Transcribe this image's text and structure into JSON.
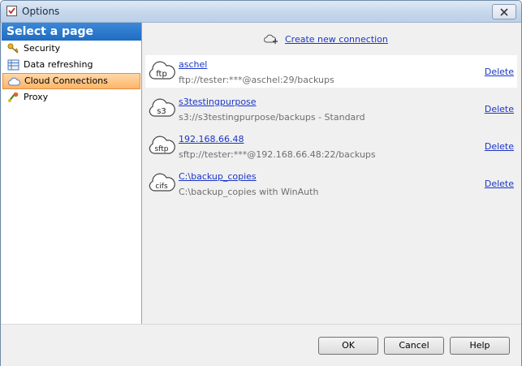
{
  "window": {
    "title": "Options"
  },
  "sidebar": {
    "header": "Select a page",
    "items": [
      {
        "label": "Security",
        "icon": "key-icon"
      },
      {
        "label": "Data refreshing",
        "icon": "refresh-table-icon"
      },
      {
        "label": "Cloud Connections",
        "icon": "cloud-icon",
        "selected": true
      },
      {
        "label": "Proxy",
        "icon": "proxy-icon"
      }
    ]
  },
  "main": {
    "create_label": "Create new connection",
    "connections": [
      {
        "type": "ftp",
        "name": "aschel",
        "detail": "ftp://tester:***@aschel:29/backups",
        "delete_label": "Delete"
      },
      {
        "type": "s3",
        "name": "s3testingpurpose",
        "detail": "s3://s3testingpurpose/backups - Standard",
        "delete_label": "Delete"
      },
      {
        "type": "sftp",
        "name": "192.168.66.48",
        "detail": "sftp://tester:***@192.168.66.48:22/backups",
        "delete_label": "Delete"
      },
      {
        "type": "cifs",
        "name": "C:\\backup_copies",
        "detail": "C:\\backup_copies with WinAuth",
        "delete_label": "Delete"
      }
    ]
  },
  "footer": {
    "ok_label": "OK",
    "cancel_label": "Cancel",
    "help_label": "Help"
  },
  "colors": {
    "link": "#1a36c8",
    "selection": "#ffb468",
    "header": "#1f6cc2"
  }
}
